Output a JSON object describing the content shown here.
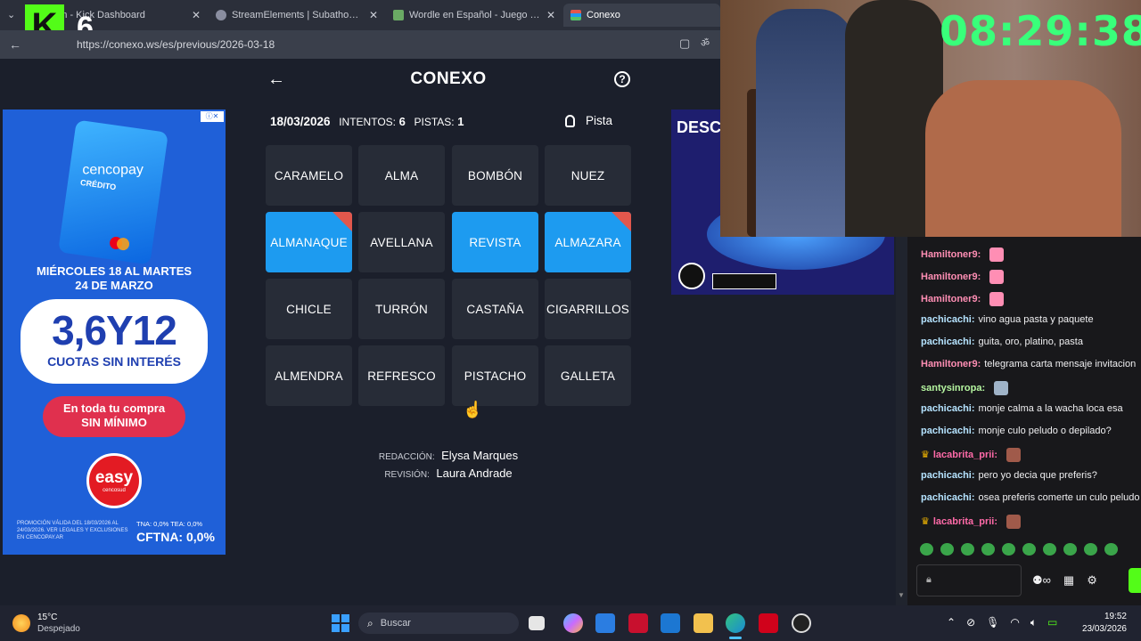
{
  "browser": {
    "tabs": [
      {
        "label": "eam - Kick Dashboard"
      },
      {
        "label": "StreamElements | Subathon Coun"
      },
      {
        "label": "Wordle en Español - Juego Diario"
      },
      {
        "label": "Conexo"
      }
    ],
    "url": "https://conexo.ws/es/previous/2026-03-18"
  },
  "overlay": {
    "badge_letter": "K",
    "badge_number": "6",
    "timer": "08:29:38"
  },
  "game": {
    "title": "CONEXO",
    "date": "18/03/2026",
    "attempts_label": "INTENTOS:",
    "attempts": "6",
    "hints_label": "PISTAS:",
    "hints": "1",
    "hint_button": "Pista",
    "tiles": [
      {
        "label": "CARAMELO",
        "selected": false,
        "flag": false
      },
      {
        "label": "ALMA",
        "selected": false,
        "flag": false
      },
      {
        "label": "BOMBÓN",
        "selected": false,
        "flag": false
      },
      {
        "label": "NUEZ",
        "selected": false,
        "flag": false
      },
      {
        "label": "ALMANAQUE",
        "selected": true,
        "flag": true
      },
      {
        "label": "AVELLANA",
        "selected": false,
        "flag": false
      },
      {
        "label": "REVISTA",
        "selected": true,
        "flag": false
      },
      {
        "label": "ALMAZARA",
        "selected": true,
        "flag": true
      },
      {
        "label": "CHICLE",
        "selected": false,
        "flag": false
      },
      {
        "label": "TURRÓN",
        "selected": false,
        "flag": false
      },
      {
        "label": "CASTAÑA",
        "selected": false,
        "flag": false
      },
      {
        "label": "CIGARRILLOS",
        "selected": false,
        "flag": false
      },
      {
        "label": "ALMENDRA",
        "selected": false,
        "flag": false
      },
      {
        "label": "REFRESCO",
        "selected": false,
        "flag": false
      },
      {
        "label": "PISTACHO",
        "selected": false,
        "flag": false
      },
      {
        "label": "GALLETA",
        "selected": false,
        "flag": false
      }
    ],
    "credits": {
      "writing_label": "REDACCIÓN:",
      "writing_name": "Elysa Marques",
      "review_label": "REVISIÓN:",
      "review_name": "Laura Andrade"
    }
  },
  "ad_left": {
    "brand": "cencopay",
    "brand_sub": "CRÉDITO",
    "dates": "MIÉRCOLES 18 AL MARTES 24 DE MARZO",
    "big": "3,6Y12",
    "cuotas": "CUOTAS SIN INTERÉS",
    "cta": "En toda tu compra SIN MÍNIMO",
    "store": "easy",
    "store_sub": "cencosud",
    "legal": "PROMOCIÓN VÁLIDA DEL 18/03/2026 AL 24/03/2026. VER LEGALES Y EXCLUSIONES EN CENCOPAY.AR",
    "tna": "TNA: 0,0% TEA: 0,0%",
    "cftna": "CFTNA: 0,0%"
  },
  "ad_right": {
    "headline": "DESCU"
  },
  "chat": {
    "messages": [
      {
        "user": "Hamiltoner9:",
        "text": "",
        "color": "#ff8eb4",
        "emote": true,
        "crown": false
      },
      {
        "user": "Hamiltoner9:",
        "text": "",
        "color": "#ff8eb4",
        "emote": true,
        "crown": false
      },
      {
        "user": "Hamiltoner9:",
        "text": "",
        "color": "#ff8eb4",
        "emote": true,
        "crown": false
      },
      {
        "user": "pachicachi:",
        "text": "vino agua pasta y paquete",
        "color": "#b5e3ff",
        "emote": false,
        "crown": false
      },
      {
        "user": "pachicachi:",
        "text": "guita, oro, platino, pasta",
        "color": "#b5e3ff",
        "emote": false,
        "crown": false
      },
      {
        "user": "Hamiltoner9:",
        "text": "telegrama carta mensaje invitacion",
        "color": "#ff8eb4",
        "emote": false,
        "crown": false
      },
      {
        "user": "santysinropa:",
        "text": "",
        "color": "#b5f5a0",
        "emote": true,
        "crown": false
      },
      {
        "user": "pachicachi:",
        "text": "monje calma a la wacha loca esa",
        "color": "#b5e3ff",
        "emote": false,
        "crown": false
      },
      {
        "user": "pachicachi:",
        "text": "monje culo peludo o depilado?",
        "color": "#b5e3ff",
        "emote": false,
        "crown": false
      },
      {
        "user": "lacabrita_prii:",
        "text": "",
        "color": "#ff6aa8",
        "emote": true,
        "crown": true
      },
      {
        "user": "pachicachi:",
        "text": "pero yo decia que preferis?",
        "color": "#b5e3ff",
        "emote": false,
        "crown": false
      },
      {
        "user": "pachicachi:",
        "text": "osea preferis comerte un culo peludo",
        "color": "#b5e3ff",
        "emote": false,
        "crown": false
      },
      {
        "user": "lacabrita_prii:",
        "text": "",
        "color": "#ff6aa8",
        "emote": true,
        "crown": true
      }
    ]
  },
  "taskbar": {
    "weather_temp": "15°C",
    "weather_desc": "Despejado",
    "search_placeholder": "Buscar",
    "time": "19:52",
    "date": "23/03/2026"
  },
  "colors": {
    "accent_blue": "#1d9bf0",
    "flag_red": "#e2574c",
    "timer_green": "#39ff7a",
    "kick_green": "#53fc18"
  }
}
